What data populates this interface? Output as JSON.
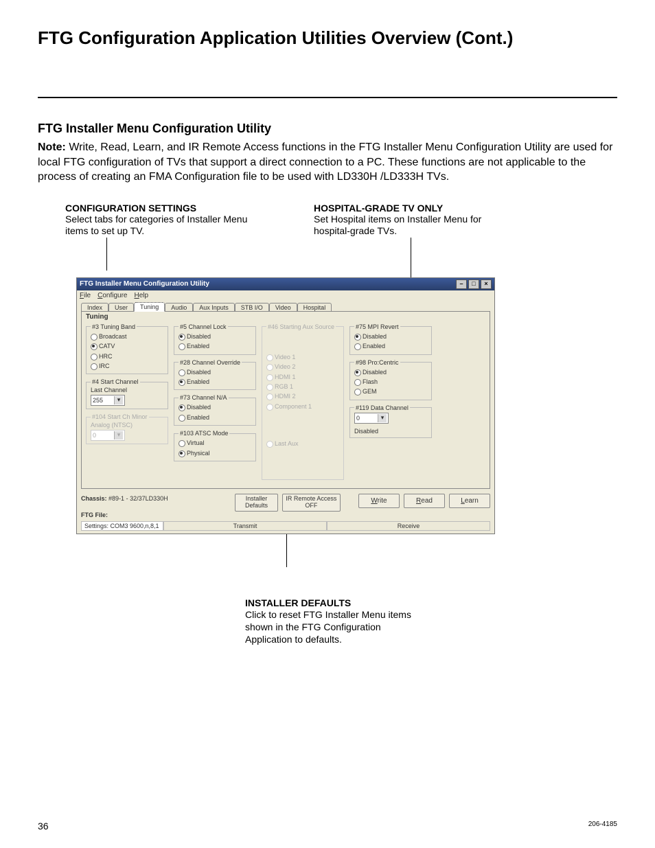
{
  "page": {
    "title": "FTG Configuration Application Utilities Overview (Cont.)",
    "subtitle": "FTG Installer Menu Configuration Utility",
    "note_bold": "Note:",
    "note": " Write, Read, Learn, and IR Remote Access functions in the FTG Installer Menu Configuration Utility are used for local FTG configuration of TVs that support a direct connection to a PC. These functions are not applicable to the process of creating an FMA Configuration file to be used with LD330H /LD333H TVs.",
    "page_number": "36",
    "doc_code": "206-4185"
  },
  "annot": {
    "cfg_title": "CONFIGURATION SETTINGS",
    "cfg_desc": "Select tabs for categories of Installer Menu items to set up TV.",
    "hos_title": "HOSPITAL-GRADE TV ONLY",
    "hos_desc": "Set Hospital items on Installer Menu for hospital-grade TVs.",
    "inst_title": "INSTALLER DEFAULTS",
    "inst_desc": "Click to reset FTG Installer Menu items shown in the FTG Configuration Application to defaults."
  },
  "win": {
    "title": "FTG Installer Menu Configuration Utility",
    "menu": {
      "file": "File",
      "configure": "Configure",
      "help": "Help"
    },
    "tabs": {
      "index": "Index",
      "user": "User",
      "tuning": "Tuning",
      "audio": "Audio",
      "aux": "Aux Inputs",
      "stb": "STB I/O",
      "video": "Video",
      "hospital": "Hospital"
    },
    "panel_name": "Tuning",
    "groups": {
      "g3": {
        "legend": "#3 Tuning Band",
        "opts": [
          "Broadcast",
          "CATV",
          "HRC",
          "IRC"
        ],
        "sel": 1
      },
      "g4": {
        "legend": "#4 Start Channel",
        "label": "Last Channel",
        "value": "255"
      },
      "g104": {
        "legend": "#104 Start Ch Minor",
        "label": "Analog (NTSC)",
        "value": "0"
      },
      "g5": {
        "legend": "#5 Channel Lock",
        "opts": [
          "Disabled",
          "Enabled"
        ],
        "sel": 0
      },
      "g28": {
        "legend": "#28 Channel Override",
        "opts": [
          "Disabled",
          "Enabled"
        ],
        "sel": 1
      },
      "g73": {
        "legend": "#73 Channel N/A",
        "opts": [
          "Disabled",
          "Enabled"
        ],
        "sel": 0
      },
      "g103": {
        "legend": "#103 ATSC Mode",
        "opts": [
          "Virtual",
          "Physical"
        ],
        "sel": 1
      },
      "g46": {
        "legend": "#46 Starting Aux Source",
        "opts": [
          "Video 1",
          "Video 2",
          "HDMI 1",
          "RGB 1",
          "HDMI 2",
          "Component 1",
          "Last Aux"
        ]
      },
      "g75": {
        "legend": "#75 MPI Revert",
        "opts": [
          "Disabled",
          "Enabled"
        ],
        "sel": 0
      },
      "g98": {
        "legend": "#98 Pro:Centric",
        "opts": [
          "Disabled",
          "Flash",
          "GEM"
        ],
        "sel": 0
      },
      "g119": {
        "legend": "#119 Data Channel",
        "value": "0",
        "below": "Disabled"
      }
    },
    "footer": {
      "chassis_label": "Chassis:",
      "chassis": "#89-1 - 32/37LD330H",
      "ftg_label": "FTG File:",
      "btn_defaults": "Installer Defaults",
      "btn_ir": "IR Remote Access OFF",
      "btn_write": "Write",
      "btn_read": "Read",
      "btn_learn": "Learn",
      "settings": "Settings: COM3 9600,n,8,1",
      "transmit": "Transmit",
      "receive": "Receive"
    }
  }
}
